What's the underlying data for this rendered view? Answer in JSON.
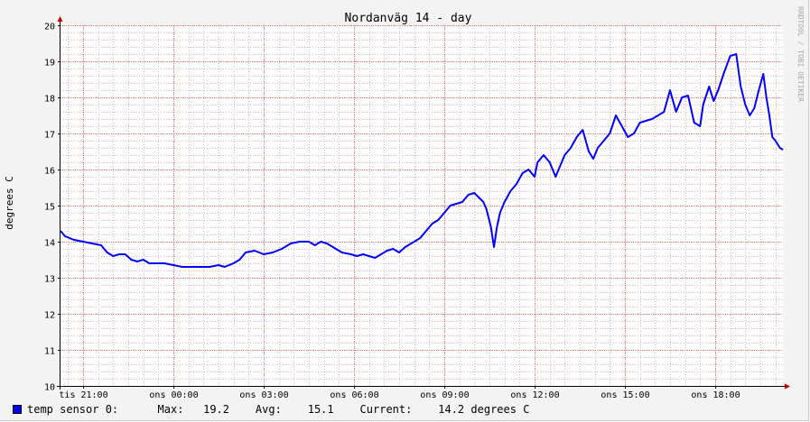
{
  "chart_data": {
    "type": "line",
    "title": "Nordanväg 14 - day",
    "ylabel": "degrees C",
    "side_label": "RRDTOOL / TOBI OETIKER",
    "ylim": [
      10,
      20
    ],
    "y_ticks": [
      "10",
      "11",
      "12",
      "13",
      "14",
      "15",
      "16",
      "17",
      "18",
      "19",
      "20"
    ],
    "xlim": [
      -3.75,
      20.25
    ],
    "x_ticks": [
      {
        "label": "tis 21:00",
        "h": -3
      },
      {
        "label": "ons 00:00",
        "h": 0
      },
      {
        "label": "ons 03:00",
        "h": 3
      },
      {
        "label": "ons 06:00",
        "h": 6
      },
      {
        "label": "ons 09:00",
        "h": 9
      },
      {
        "label": "ons 12:00",
        "h": 12
      },
      {
        "label": "ons 15:00",
        "h": 15
      },
      {
        "label": "ons 18:00",
        "h": 18
      }
    ],
    "grid": true,
    "colors": {
      "line": "#0000ff",
      "major_grid": "#e08080",
      "minor_grid": "#e8b0b0",
      "axis": "#000000",
      "arrow": "#c00000"
    },
    "series": [
      {
        "name": "temp sensor 0",
        "points": [
          [
            -3.75,
            14.3
          ],
          [
            -3.6,
            14.15
          ],
          [
            -3.3,
            14.05
          ],
          [
            -3.0,
            14.0
          ],
          [
            -2.7,
            13.95
          ],
          [
            -2.4,
            13.9
          ],
          [
            -2.2,
            13.7
          ],
          [
            -2.0,
            13.6
          ],
          [
            -1.8,
            13.65
          ],
          [
            -1.6,
            13.65
          ],
          [
            -1.4,
            13.5
          ],
          [
            -1.2,
            13.45
          ],
          [
            -1.0,
            13.5
          ],
          [
            -0.8,
            13.4
          ],
          [
            -0.5,
            13.4
          ],
          [
            -0.3,
            13.4
          ],
          [
            0.0,
            13.35
          ],
          [
            0.3,
            13.3
          ],
          [
            0.6,
            13.3
          ],
          [
            0.9,
            13.3
          ],
          [
            1.2,
            13.3
          ],
          [
            1.5,
            13.35
          ],
          [
            1.7,
            13.3
          ],
          [
            2.0,
            13.4
          ],
          [
            2.2,
            13.5
          ],
          [
            2.4,
            13.7
          ],
          [
            2.7,
            13.75
          ],
          [
            3.0,
            13.65
          ],
          [
            3.3,
            13.7
          ],
          [
            3.6,
            13.8
          ],
          [
            3.9,
            13.95
          ],
          [
            4.2,
            14.0
          ],
          [
            4.5,
            14.0
          ],
          [
            4.7,
            13.9
          ],
          [
            4.9,
            14.0
          ],
          [
            5.1,
            13.95
          ],
          [
            5.3,
            13.85
          ],
          [
            5.6,
            13.7
          ],
          [
            5.9,
            13.65
          ],
          [
            6.1,
            13.6
          ],
          [
            6.3,
            13.65
          ],
          [
            6.5,
            13.6
          ],
          [
            6.7,
            13.55
          ],
          [
            6.9,
            13.65
          ],
          [
            7.1,
            13.75
          ],
          [
            7.3,
            13.8
          ],
          [
            7.5,
            13.7
          ],
          [
            7.7,
            13.85
          ],
          [
            8.0,
            14.0
          ],
          [
            8.2,
            14.1
          ],
          [
            8.4,
            14.3
          ],
          [
            8.6,
            14.5
          ],
          [
            8.8,
            14.6
          ],
          [
            9.0,
            14.8
          ],
          [
            9.2,
            15.0
          ],
          [
            9.4,
            15.05
          ],
          [
            9.6,
            15.1
          ],
          [
            9.8,
            15.3
          ],
          [
            10.0,
            15.35
          ],
          [
            10.3,
            15.1
          ],
          [
            10.4,
            14.9
          ],
          [
            10.55,
            14.4
          ],
          [
            10.65,
            13.85
          ],
          [
            10.75,
            14.4
          ],
          [
            10.85,
            14.8
          ],
          [
            11.0,
            15.1
          ],
          [
            11.2,
            15.4
          ],
          [
            11.4,
            15.6
          ],
          [
            11.6,
            15.9
          ],
          [
            11.8,
            16.0
          ],
          [
            12.0,
            15.8
          ],
          [
            12.1,
            16.2
          ],
          [
            12.3,
            16.4
          ],
          [
            12.5,
            16.2
          ],
          [
            12.7,
            15.8
          ],
          [
            12.85,
            16.1
          ],
          [
            13.0,
            16.4
          ],
          [
            13.2,
            16.6
          ],
          [
            13.4,
            16.9
          ],
          [
            13.6,
            17.1
          ],
          [
            13.8,
            16.5
          ],
          [
            13.95,
            16.3
          ],
          [
            14.1,
            16.6
          ],
          [
            14.3,
            16.8
          ],
          [
            14.5,
            17.0
          ],
          [
            14.7,
            17.5
          ],
          [
            14.9,
            17.2
          ],
          [
            15.1,
            16.9
          ],
          [
            15.3,
            17.0
          ],
          [
            15.5,
            17.3
          ],
          [
            15.7,
            17.35
          ],
          [
            15.9,
            17.4
          ],
          [
            16.1,
            17.5
          ],
          [
            16.3,
            17.6
          ],
          [
            16.5,
            18.2
          ],
          [
            16.7,
            17.6
          ],
          [
            16.9,
            18.0
          ],
          [
            17.1,
            18.05
          ],
          [
            17.3,
            17.3
          ],
          [
            17.5,
            17.2
          ],
          [
            17.6,
            17.8
          ],
          [
            17.8,
            18.3
          ],
          [
            17.95,
            17.9
          ],
          [
            18.1,
            18.2
          ],
          [
            18.3,
            18.7
          ],
          [
            18.5,
            19.15
          ],
          [
            18.7,
            19.2
          ],
          [
            18.85,
            18.3
          ],
          [
            19.0,
            17.8
          ],
          [
            19.15,
            17.5
          ],
          [
            19.3,
            17.7
          ],
          [
            19.45,
            18.2
          ],
          [
            19.6,
            18.65
          ],
          [
            19.7,
            18.0
          ],
          [
            19.8,
            17.5
          ],
          [
            19.9,
            16.9
          ],
          [
            20.0,
            16.8
          ],
          [
            20.15,
            16.6
          ],
          [
            20.25,
            16.55
          ]
        ]
      }
    ],
    "legend": {
      "label": "temp sensor 0:",
      "max_label": "Max:",
      "max": "19.2",
      "avg_label": "Avg:",
      "avg": "15.1",
      "current_label": "Current:",
      "current": "14.2",
      "unit": "degrees C"
    }
  }
}
